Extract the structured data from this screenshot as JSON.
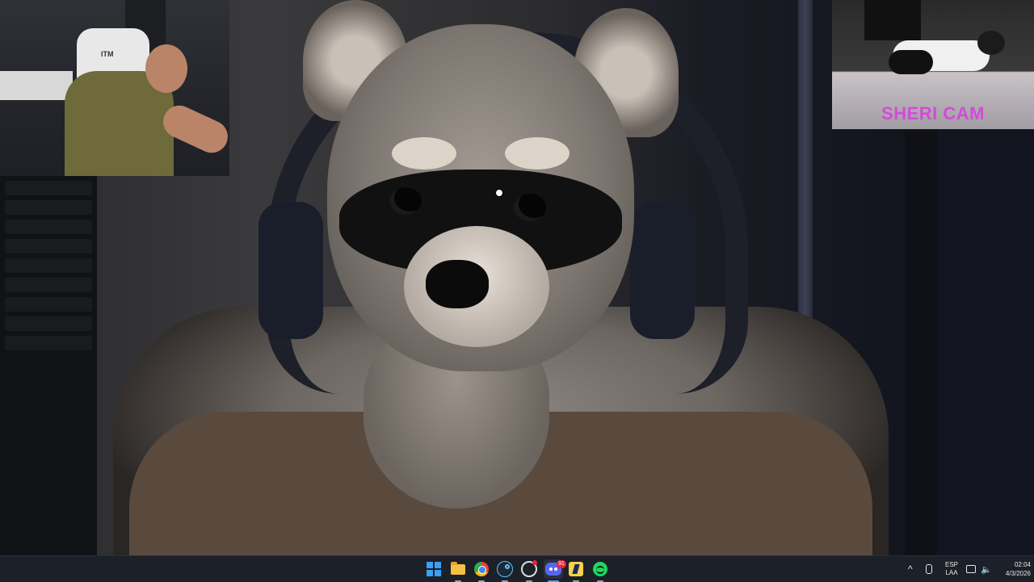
{
  "catcam": {
    "label": "SHERI CAM"
  },
  "webcam": {
    "chair_tag": "ITM"
  },
  "taskbar": {
    "apps": [
      {
        "name": "start",
        "icon": "windows-icon"
      },
      {
        "name": "file-explorer",
        "icon": "folder-icon"
      },
      {
        "name": "chrome",
        "icon": "chrome-icon"
      },
      {
        "name": "steam",
        "icon": "steam-icon"
      },
      {
        "name": "app",
        "icon": "circle-app-icon"
      },
      {
        "name": "discord",
        "icon": "discord-icon",
        "badge": "91"
      },
      {
        "name": "kick",
        "icon": "kick-icon"
      },
      {
        "name": "spotify",
        "icon": "spotify-icon"
      }
    ],
    "tray": {
      "chevron": "^",
      "lang_line1": "ESP",
      "lang_line2": "LAA",
      "time": "02:04",
      "date": "4/3/2026"
    }
  },
  "colors": {
    "label_magenta": "#d24cd8",
    "taskbar_bg": "#1c2028"
  }
}
